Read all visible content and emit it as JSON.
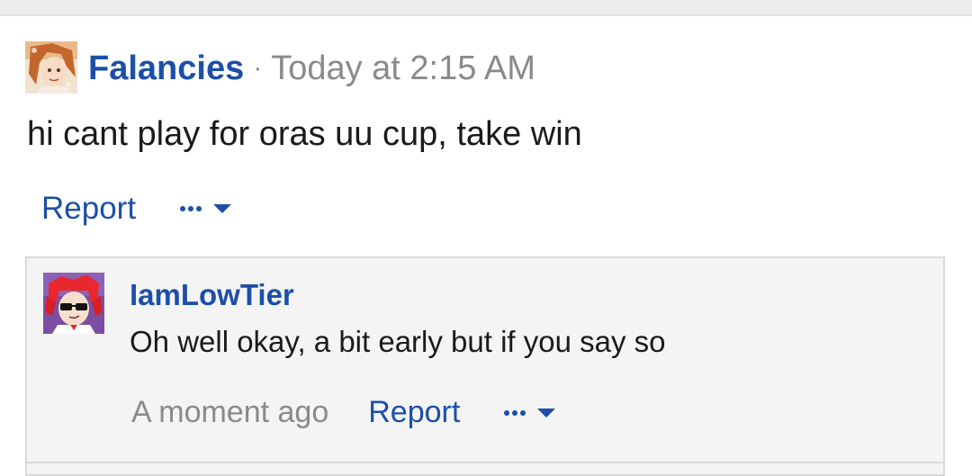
{
  "post": {
    "username": "Falancies",
    "separator": "·",
    "timestamp": "Today at 2:15 AM",
    "message": "hi cant play for oras uu cup, take win",
    "report_label": "Report",
    "more_icon": "ellipsis-dropdown-icon"
  },
  "reply": {
    "username": "IamLowTier",
    "message": "Oh well okay, a bit early but if you say so",
    "timestamp": "A moment ago",
    "report_label": "Report",
    "more_icon": "ellipsis-dropdown-icon"
  },
  "colors": {
    "link_blue": "#1c4fa8",
    "muted_gray": "#8a8a8a",
    "reply_bg": "#f4f4f4"
  }
}
